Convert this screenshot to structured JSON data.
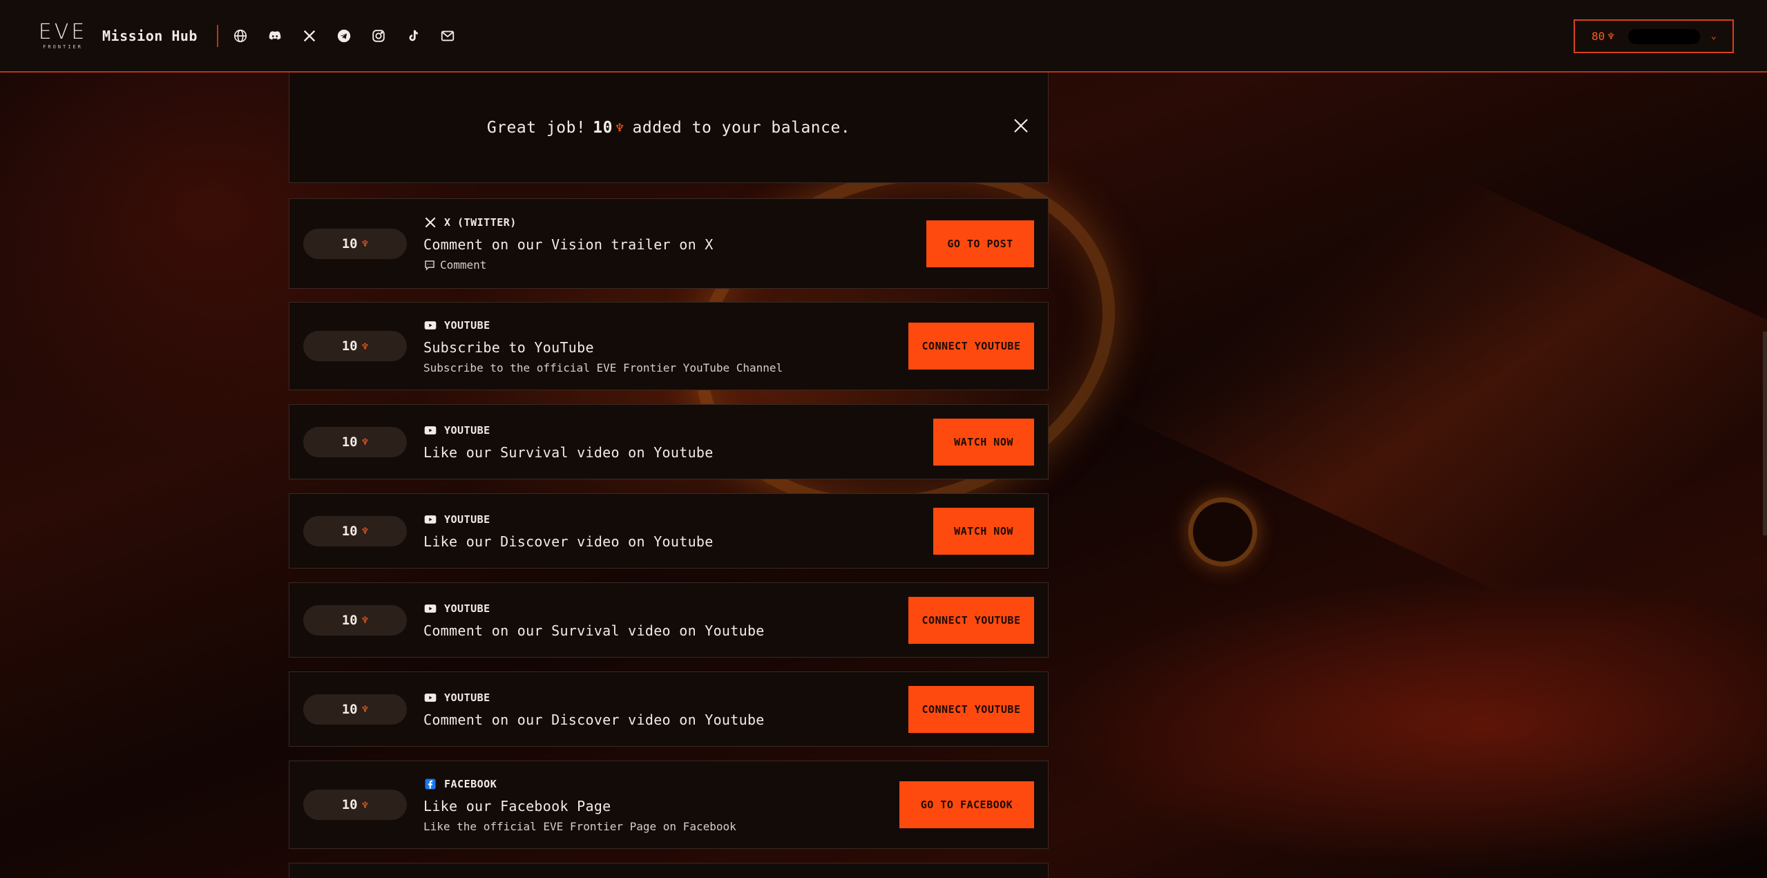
{
  "header": {
    "logo_main": "EVE",
    "logo_sub": "FRONTIER",
    "title": "Mission Hub",
    "socials": [
      "globe-icon",
      "discord-icon",
      "x-icon",
      "telegram-icon",
      "instagram-icon",
      "tiktok-icon",
      "mail-icon"
    ],
    "balance_value": "80",
    "balance_icon": "♆",
    "chevron": "⌄"
  },
  "toast": {
    "prefix": "Great job!",
    "amount": "10",
    "icon": "♆",
    "suffix": "added to your balance."
  },
  "missions": [
    {
      "reward": "10",
      "icon": "♆",
      "platform": "X (TWITTER)",
      "title": "Comment on our Vision trailer on X",
      "desc": "Comment",
      "button": "GO TO POST"
    },
    {
      "reward": "10",
      "icon": "♆",
      "platform": "YOUTUBE",
      "title": "Subscribe to YouTube",
      "desc": "Subscribe to the official EVE Frontier YouTube Channel",
      "button": "CONNECT YOUTUBE"
    },
    {
      "reward": "10",
      "icon": "♆",
      "platform": "YOUTUBE",
      "title": "Like our Survival video on Youtube",
      "desc": "",
      "button": "WATCH NOW"
    },
    {
      "reward": "10",
      "icon": "♆",
      "platform": "YOUTUBE",
      "title": "Like our Discover video on Youtube",
      "desc": "",
      "button": "WATCH NOW"
    },
    {
      "reward": "10",
      "icon": "♆",
      "platform": "YOUTUBE",
      "title": "Comment on our Survival video on Youtube",
      "desc": "",
      "button": "CONNECT YOUTUBE"
    },
    {
      "reward": "10",
      "icon": "♆",
      "platform": "YOUTUBE",
      "title": "Comment on our Discover video on Youtube",
      "desc": "",
      "button": "CONNECT YOUTUBE"
    },
    {
      "reward": "10",
      "icon": "♆",
      "platform": "FACEBOOK",
      "title": "Like our Facebook Page",
      "desc": "Like the official EVE Frontier Page on Facebook",
      "button": "GO TO FACEBOOK"
    }
  ],
  "colors": {
    "accent": "#ff4a0f",
    "header_border": "#b5361a",
    "card_bg": "#130b08"
  }
}
